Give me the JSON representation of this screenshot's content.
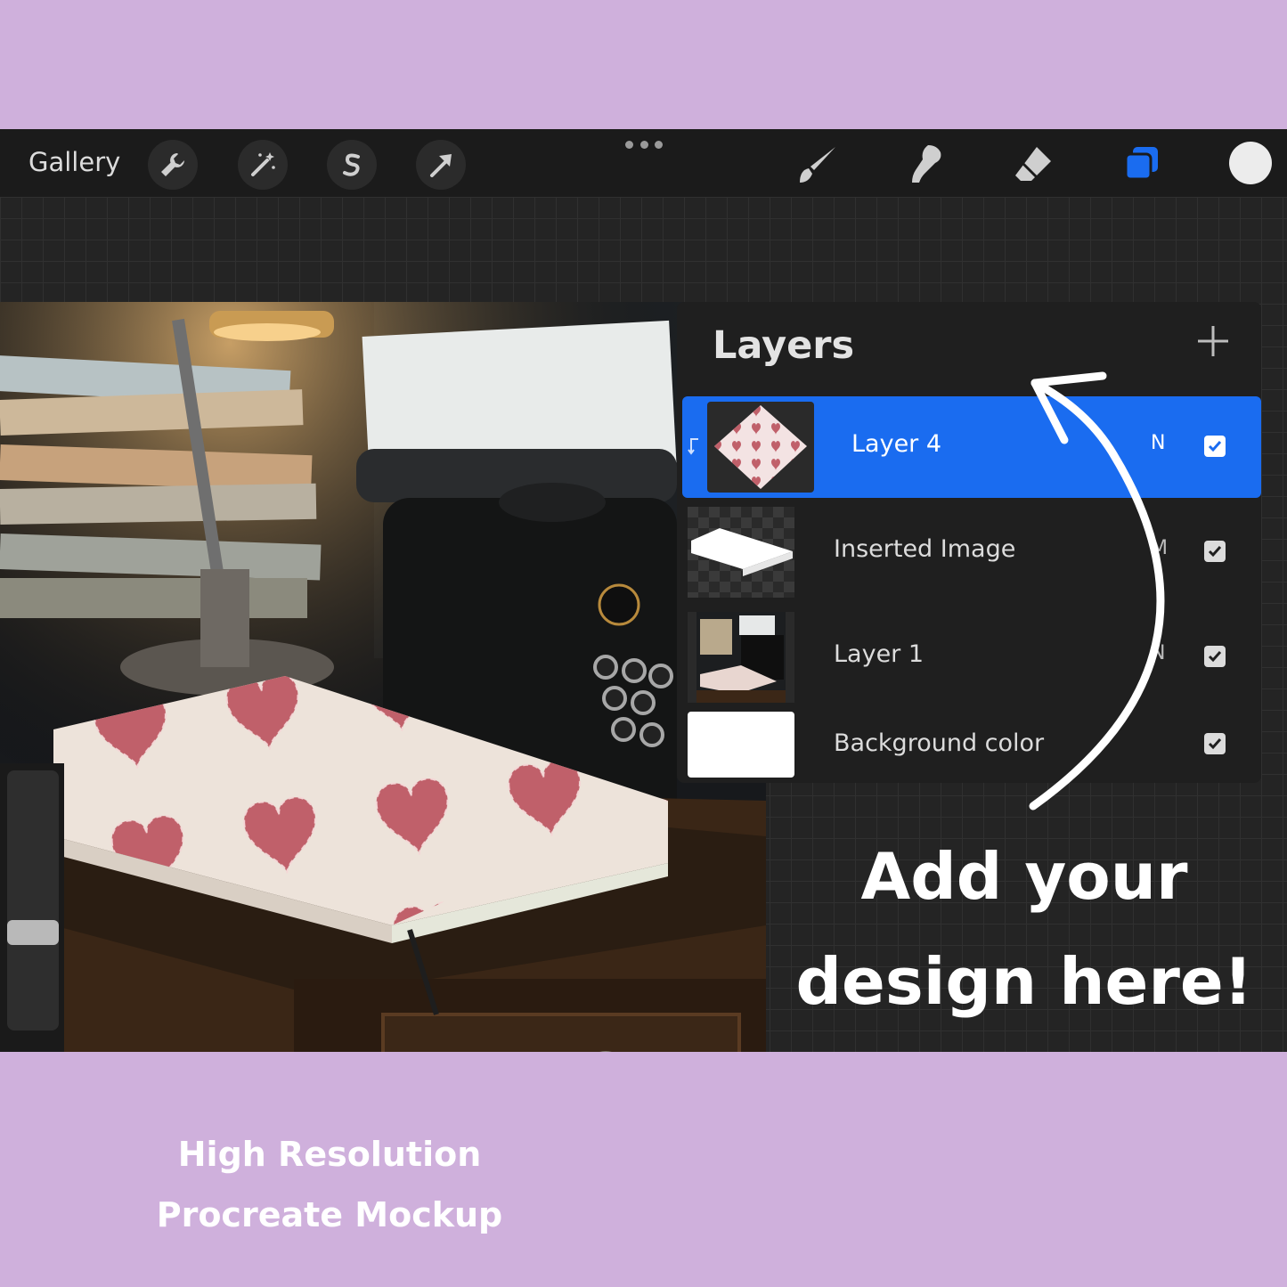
{
  "toolbar": {
    "gallery_label": "Gallery",
    "left_tools": [
      "wrench-icon",
      "magic-wand-icon",
      "selection-s-icon",
      "transform-arrow-icon"
    ],
    "right_tools": [
      "brush-icon",
      "smudge-icon",
      "eraser-icon",
      "layers-icon"
    ],
    "active_color": "#ececec",
    "accent": "#1a6cf0"
  },
  "layers_panel": {
    "title": "Layers",
    "layers": [
      {
        "name": "Layer 4",
        "blend": "N",
        "visible": true,
        "selected": true,
        "clipping": true
      },
      {
        "name": "Inserted Image",
        "blend": "M",
        "visible": true,
        "selected": false
      },
      {
        "name": "Layer 1",
        "blend": "N",
        "visible": true,
        "selected": false
      },
      {
        "name": "Background color",
        "blend": "",
        "visible": true,
        "selected": false
      }
    ]
  },
  "overlay": {
    "cta_line1": "Add your",
    "cta_line2": "design here!"
  },
  "footer": {
    "line1": "High Resolution",
    "line2": "Procreate Mockup"
  },
  "colors": {
    "band": "#cfb0dc",
    "app_bg": "#262626",
    "heart": "#c0606a"
  }
}
